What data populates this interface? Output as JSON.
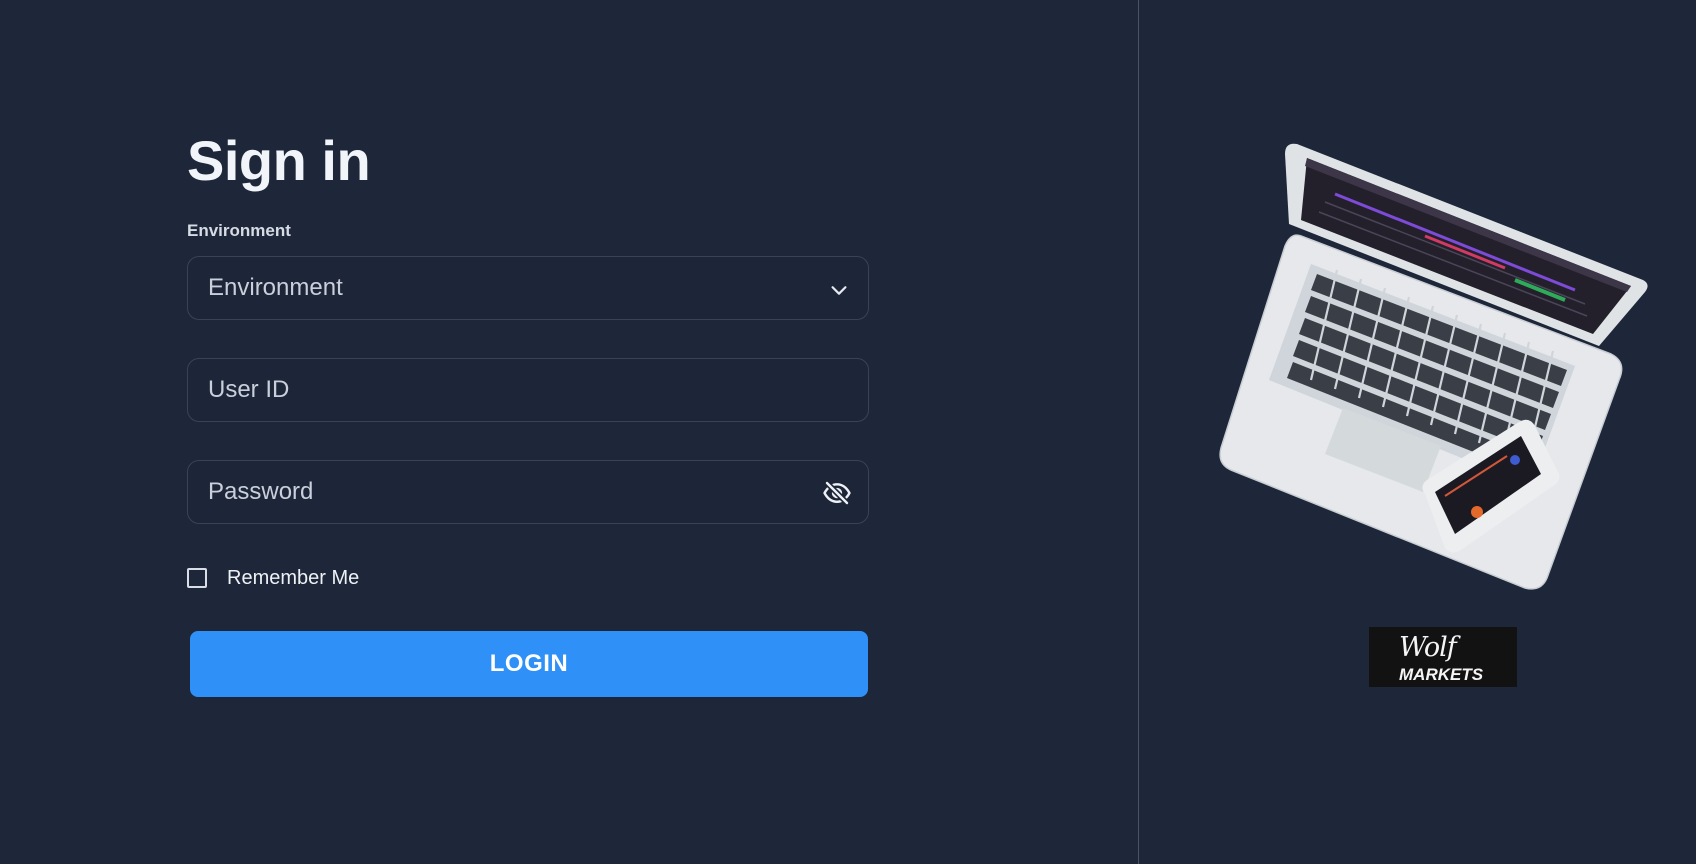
{
  "form": {
    "title": "Sign in",
    "environment_label": "Environment",
    "environment_select": {
      "selected": "Environment"
    },
    "user_id": {
      "placeholder": "User ID"
    },
    "password": {
      "placeholder": "Password"
    },
    "remember_me": {
      "label": "Remember Me",
      "checked": false
    },
    "login_button": "LOGIN"
  },
  "branding": {
    "logo_line1": "Wolf",
    "logo_line2": "MARKETS"
  },
  "colors": {
    "background": "#1e2739",
    "accent": "#2f90f7",
    "field_border": "#3a4356",
    "divider": "#4a5264"
  },
  "icons": {
    "select_chevron": "chevron-down-icon",
    "password_toggle": "eye-off-icon"
  }
}
